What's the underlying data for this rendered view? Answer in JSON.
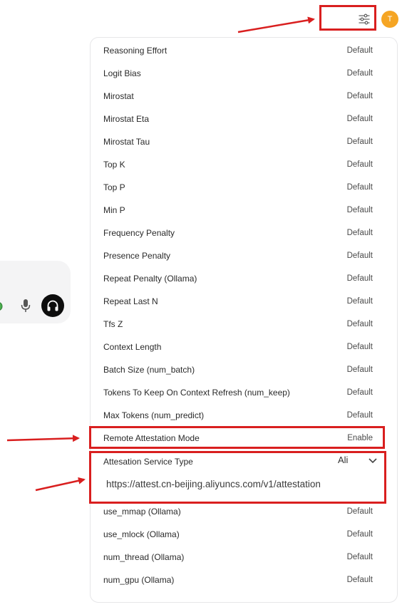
{
  "header": {
    "controls_icon": "sliders-icon",
    "avatar_initial": "T"
  },
  "chat": {
    "emoji_icon": "emoji-icon",
    "mic_icon": "microphone-icon",
    "call_icon": "headphones-icon"
  },
  "settings": {
    "rows_top": [
      {
        "label": "Reasoning Effort",
        "value": "Default"
      },
      {
        "label": "Logit Bias",
        "value": "Default"
      },
      {
        "label": "Mirostat",
        "value": "Default"
      },
      {
        "label": "Mirostat Eta",
        "value": "Default"
      },
      {
        "label": "Mirostat Tau",
        "value": "Default"
      },
      {
        "label": "Top K",
        "value": "Default"
      },
      {
        "label": "Top P",
        "value": "Default"
      },
      {
        "label": "Min P",
        "value": "Default"
      },
      {
        "label": "Frequency Penalty",
        "value": "Default"
      },
      {
        "label": "Presence Penalty",
        "value": "Default"
      },
      {
        "label": "Repeat Penalty (Ollama)",
        "value": "Default"
      },
      {
        "label": "Repeat Last N",
        "value": "Default"
      },
      {
        "label": "Tfs Z",
        "value": "Default"
      },
      {
        "label": "Context Length",
        "value": "Default"
      },
      {
        "label": "Batch Size (num_batch)",
        "value": "Default"
      },
      {
        "label": "Tokens To Keep On Context Refresh (num_keep)",
        "value": "Default"
      },
      {
        "label": "Max Tokens (num_predict)",
        "value": "Default"
      },
      {
        "label": "Remote Attestation Mode",
        "value": "Enable"
      }
    ],
    "attestation": {
      "label": "Attesation Service Type",
      "selected": "Ali",
      "url": "https://attest.cn-beijing.aliyuncs.com/v1/attestation"
    },
    "rows_bottom": [
      {
        "label": "use_mmap (Ollama)",
        "value": "Default"
      },
      {
        "label": "use_mlock (Ollama)",
        "value": "Default"
      },
      {
        "label": "num_thread (Ollama)",
        "value": "Default"
      },
      {
        "label": "num_gpu (Ollama)",
        "value": "Default"
      }
    ]
  },
  "colors": {
    "highlight": "#d91f1f",
    "avatar": "#f5a524",
    "panel_border": "#e6e6e8"
  }
}
